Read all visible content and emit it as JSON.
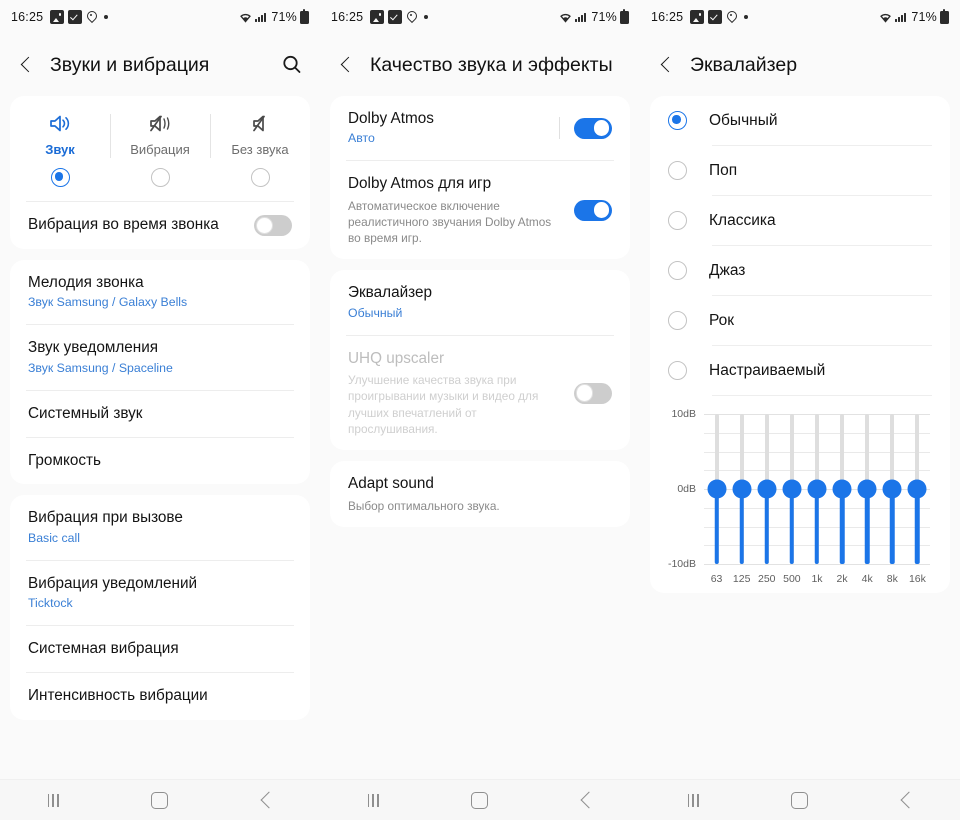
{
  "status_bar": {
    "time": "16:25",
    "battery": "71%",
    "left_icons": [
      "gallery-icon",
      "checkbox-icon",
      "location-pin-icon",
      "dot-icon"
    ],
    "right_icons": [
      "wifi-icon",
      "signal-icon",
      "battery-icon"
    ]
  },
  "nav_bar": {
    "recents_label": "recents-button",
    "home_label": "home-button",
    "back_label": "back-button"
  },
  "colors": {
    "accent": "#1b75e8",
    "link": "#3a7fd5",
    "card": "#ffffff",
    "page_bg": "#fafafa",
    "disabled": "#bdbdbd"
  },
  "screen1": {
    "title": "Звуки и вибрация",
    "search_icon": "search-icon",
    "back_icon": "back-chevron-icon",
    "modes": [
      {
        "label": "Звук",
        "icon": "speaker-on-icon",
        "selected": true
      },
      {
        "label": "Вибрация",
        "icon": "speaker-vibrate-icon",
        "selected": false
      },
      {
        "label": "Без звука",
        "icon": "speaker-mute-icon",
        "selected": false
      }
    ],
    "vibrate_while_ringing": {
      "title": "Вибрация во время звонка",
      "enabled": false
    },
    "group_sound": [
      {
        "title": "Мелодия звонка",
        "sub": "Звук Samsung / Galaxy Bells"
      },
      {
        "title": "Звук уведомления",
        "sub": "Звук Samsung / Spaceline"
      },
      {
        "title": "Системный звук",
        "sub": ""
      },
      {
        "title": "Громкость",
        "sub": ""
      }
    ],
    "group_vibration": [
      {
        "title": "Вибрация при вызове",
        "sub": "Basic call"
      },
      {
        "title": "Вибрация уведомлений",
        "sub": "Ticktock"
      },
      {
        "title": "Системная вибрация",
        "sub": ""
      },
      {
        "title": "Интенсивность вибрации",
        "sub": ""
      }
    ]
  },
  "screen2": {
    "title": "Качество звука и эффекты",
    "back_icon": "back-chevron-icon",
    "group1": [
      {
        "title": "Dolby Atmos",
        "sub": "Авто",
        "desc": "",
        "toggle": true,
        "disabled": false,
        "divider": true
      },
      {
        "title": "Dolby Atmos для игр",
        "sub": "",
        "desc": "Автоматическое включение реалистичного звучания Dolby Atmos во время игр.",
        "toggle": true,
        "disabled": false,
        "divider": false
      }
    ],
    "group2": [
      {
        "title": "Эквалайзер",
        "sub": "Обычный",
        "desc": "",
        "toggle": null,
        "disabled": false
      },
      {
        "title": "UHQ upscaler",
        "sub": "",
        "desc": "Улучшение качества звука при проигрывании музыки и видео для лучших впечатлений от прослушивания.",
        "toggle": false,
        "disabled": true
      }
    ],
    "group3": [
      {
        "title": "Adapt sound",
        "sub": "",
        "desc": "Выбор оптимального звука.",
        "toggle": null,
        "disabled": false
      }
    ]
  },
  "screen3": {
    "title": "Эквалайзер",
    "back_icon": "back-chevron-icon",
    "presets": [
      {
        "label": "Обычный",
        "selected": true
      },
      {
        "label": "Поп",
        "selected": false
      },
      {
        "label": "Классика",
        "selected": false
      },
      {
        "label": "Джаз",
        "selected": false
      },
      {
        "label": "Рок",
        "selected": false
      },
      {
        "label": "Настраиваемый",
        "selected": false
      }
    ],
    "chart_data": {
      "type": "bar",
      "title": "",
      "xlabel": "",
      "ylabel": "dB",
      "categories": [
        "63",
        "125",
        "250",
        "500",
        "1k",
        "2k",
        "4k",
        "8k",
        "16k"
      ],
      "values": [
        0,
        0,
        0,
        0,
        0,
        0,
        0,
        0,
        0
      ],
      "ylim": [
        -10,
        10
      ],
      "ytick_labels": [
        "10dB",
        "0dB",
        "-10dB"
      ],
      "ytick_values": [
        10,
        0,
        -10
      ],
      "grid": true,
      "gridlines": [
        10,
        7.5,
        5,
        2.5,
        0,
        -2.5,
        -5,
        -7.5,
        -10
      ],
      "legend": "none"
    }
  }
}
